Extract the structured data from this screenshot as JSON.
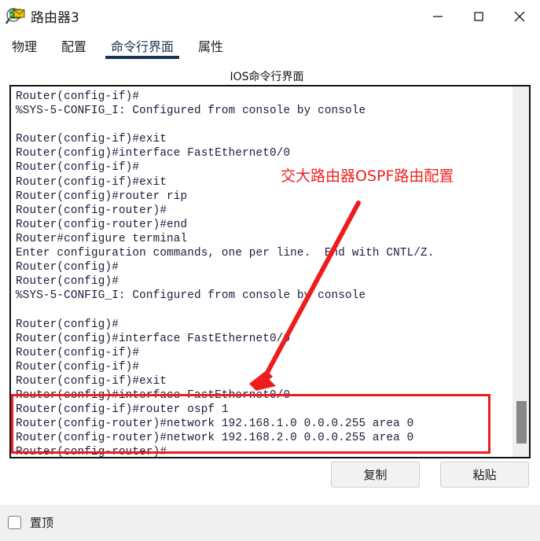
{
  "window": {
    "title": "路由器3",
    "icon": "router-magnifier-icon",
    "controls": {
      "minimize": "minimize-icon",
      "maximize": "maximize-icon",
      "close": "close-icon"
    }
  },
  "tabs": [
    {
      "label": "物理",
      "active": false
    },
    {
      "label": "配置",
      "active": false
    },
    {
      "label": "命令行界面",
      "active": true
    },
    {
      "label": "属性",
      "active": false
    }
  ],
  "panel": {
    "heading": "IOS命令行界面"
  },
  "terminal": {
    "lines": [
      "Router(config-if)#",
      "%SYS-5-CONFIG_I: Configured from console by console",
      "",
      "Router(config-if)#exit",
      "Router(config)#interface FastEthernet0/0",
      "Router(config-if)#",
      "Router(config-if)#exit",
      "Router(config)#router rip",
      "Router(config-router)#",
      "Router(config-router)#end",
      "Router#configure terminal",
      "Enter configuration commands, one per line.  End with CNTL/Z.",
      "Router(config)#",
      "Router(config)#",
      "%SYS-5-CONFIG_I: Configured from console by console",
      "",
      "Router(config)#",
      "Router(config)#interface FastEthernet0/0",
      "Router(config-if)#",
      "Router(config-if)#",
      "Router(config-if)#exit",
      "Router(config)#interface FastEthernet0/0",
      "Router(config-if)#router ospf 1",
      "Router(config-router)#network 192.168.1.0 0.0.0.255 area 0",
      "Router(config-router)#network 192.168.2.0 0.0.0.255 area 0",
      "Router(config-router)#"
    ],
    "scroll_thumb_top_pct": 85
  },
  "annotation": {
    "text": "交大路由器OSPF路由配置",
    "color": "#ee2222",
    "arrow": "red-arrow",
    "highlight_box": "red-highlight-box"
  },
  "actions": {
    "copy": "复制",
    "paste": "粘贴"
  },
  "footer": {
    "always_on_top_label": "置顶",
    "always_on_top_checked": false
  },
  "colors": {
    "accent": "#1b3354",
    "annotation_red": "#ee1c1c",
    "terminal_text": "#1c1c3c"
  }
}
